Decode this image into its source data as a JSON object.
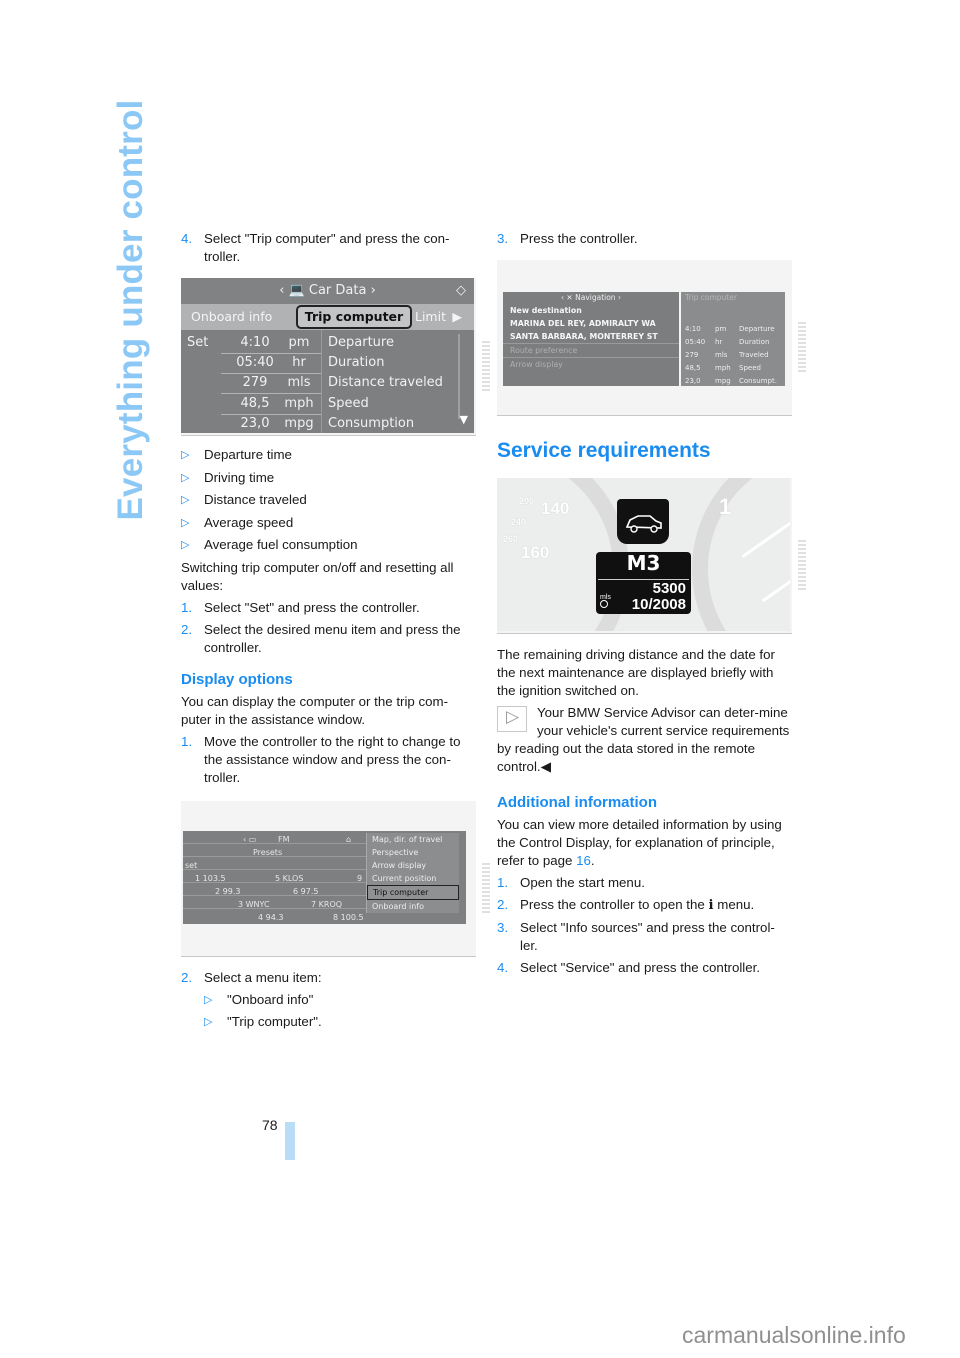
{
  "sidebar": {
    "title": "Everything under control"
  },
  "page": {
    "number": "78"
  },
  "watermark": "carmanualsonline.info",
  "left": {
    "step4": {
      "num": "4.",
      "text": "Select \"Trip computer\" and press the con-troller."
    },
    "fig1": {
      "header": "Car Data",
      "header_icon": "computer-icon",
      "tabs": [
        "Onboard info",
        "Trip computer",
        "Limit"
      ],
      "active_tab": "Trip computer",
      "set_label": "Set",
      "rows": [
        {
          "value": "4:10",
          "unit": "pm",
          "label": "Departure"
        },
        {
          "value": "05:40",
          "unit": "hr",
          "label": "Duration"
        },
        {
          "value": "279",
          "unit": "mls",
          "label": "Distance traveled"
        },
        {
          "value": "48,5",
          "unit": "mph",
          "label": "Speed"
        },
        {
          "value": "23,0",
          "unit": "mpg",
          "label": "Consumption"
        }
      ]
    },
    "bullets": [
      "Departure time",
      "Driving time",
      "Distance traveled",
      "Average speed",
      "Average fuel consumption"
    ],
    "switch_text": "Switching trip computer on/off and resetting all values:",
    "switch_steps": [
      {
        "num": "1.",
        "text": "Select \"Set\" and press the controller."
      },
      {
        "num": "2.",
        "text": "Select the desired menu item and press the controller."
      }
    ],
    "display_options": {
      "heading": "Display options",
      "intro": "You can display the computer or the trip com-puter in the assistance window.",
      "step1": {
        "num": "1.",
        "text": "Move the controller to the right to change to the assistance window and press the con-troller."
      }
    },
    "fig2": {
      "header": "FM",
      "subheader": "Presets",
      "set_label": "set",
      "presets": [
        {
          "label": "1 103.5"
        },
        {
          "label": "5 KLOS"
        },
        {
          "label": "9"
        },
        {
          "label": "2 99.3"
        },
        {
          "label": "6 97.5"
        },
        {
          "label": "3 WNYC"
        },
        {
          "label": "7 KROQ"
        },
        {
          "label": "4 94.3"
        },
        {
          "label": "8 100.5"
        }
      ],
      "menu": [
        "Map, dir. of travel",
        "Perspective",
        "Arrow display",
        "Current position",
        "Trip computer",
        "Onboard info"
      ],
      "menu_selected": "Trip computer"
    },
    "step2": {
      "num": "2.",
      "text": "Select a menu item:",
      "options": [
        "\"Onboard info\"",
        "\"Trip computer\"."
      ]
    }
  },
  "right": {
    "step3": {
      "num": "3.",
      "text": "Press the controller."
    },
    "fig3": {
      "nav_header": "Navigation",
      "nav_lines": [
        "New destination",
        "MARINA DEL REY, ADMIRALTY WA",
        "SANTA BARBARA, MONTERREY ST"
      ],
      "nav_dim_lines": [
        "Route preference",
        "Arrow display"
      ],
      "trip_header": "Trip computer",
      "trip_rows": [
        {
          "value": "4:10",
          "unit": "pm",
          "label": "Departure"
        },
        {
          "value": "05:40",
          "unit": "hr",
          "label": "Duration"
        },
        {
          "value": "279",
          "unit": "mls",
          "label": "Traveled"
        },
        {
          "value": "48,5",
          "unit": "mph",
          "label": "Speed"
        },
        {
          "value": "23,0",
          "unit": "mpg",
          "label": "Consumpt."
        }
      ]
    },
    "service": {
      "heading": "Service requirements",
      "fig": {
        "model": "M3",
        "unit": "mls",
        "distance": "5300",
        "date": "10/2008",
        "gauge_labels": [
          "200",
          "140",
          "160",
          "240",
          "260",
          "1"
        ]
      },
      "text": "The remaining driving distance and the date for the next maintenance are displayed briefly with the ignition switched on.",
      "note": "Your BMW Service Advisor can deter-mine your vehicle's current service requirements by reading out the data stored in the remote control.",
      "note_end": "◀"
    },
    "additional": {
      "heading": "Additional information",
      "intro_before": "You can view more detailed information by using the Control Display, for explanation of principle, refer to page ",
      "intro_link": "16",
      "intro_after": ".",
      "steps": [
        {
          "num": "1.",
          "text": "Open the start menu."
        },
        {
          "num": "2.",
          "text_before": "Press the controller to open the ",
          "icon": "i",
          "text_after": " menu."
        },
        {
          "num": "3.",
          "text": "Select \"Info sources\" and press the control-ler."
        },
        {
          "num": "4.",
          "text": "Select \"Service\" and press the controller."
        }
      ]
    }
  }
}
